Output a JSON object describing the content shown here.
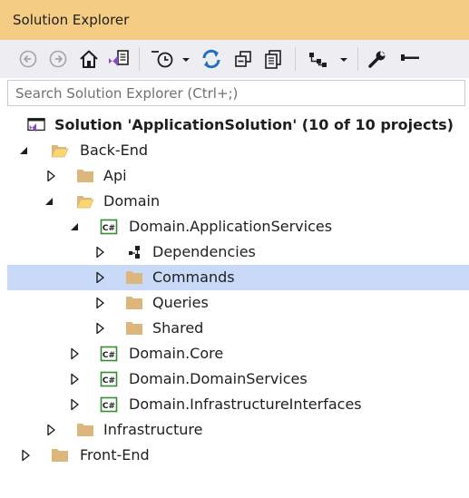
{
  "window": {
    "title": "Solution Explorer"
  },
  "toolbar": {
    "buttons": [
      {
        "name": "back-button",
        "icon": "back-arrow-icon"
      },
      {
        "name": "forward-button",
        "icon": "forward-arrow-icon"
      },
      {
        "name": "home-button",
        "icon": "home-icon"
      },
      {
        "name": "switch-views-button",
        "icon": "switch-views-icon"
      },
      {
        "name": "pending-changes-filter-button",
        "icon": "clock-icon"
      },
      {
        "name": "sync-active-document-button",
        "icon": "sync-icon"
      },
      {
        "name": "collapse-all-button",
        "icon": "collapse-all-icon"
      },
      {
        "name": "show-all-files-button",
        "icon": "show-all-files-icon"
      },
      {
        "name": "view-class-diagram-button",
        "icon": "hierarchy-icon"
      },
      {
        "name": "properties-button",
        "icon": "wrench-icon"
      },
      {
        "name": "preview-selected-items-button",
        "icon": "preview-icon"
      }
    ],
    "colors": {
      "disabled": "#a5a5a5",
      "enabled": "#1e1e1e",
      "accent": "#1f6fc5"
    }
  },
  "search": {
    "placeholder": "Search Solution Explorer (Ctrl+;)",
    "value": ""
  },
  "tree": {
    "solution": {
      "label": "Solution 'ApplicationSolution' (10 of 10 projects)"
    },
    "items": [
      {
        "label": "Back-End",
        "kind": "folder-open",
        "expanded": true,
        "level": 1
      },
      {
        "label": "Api",
        "kind": "folder",
        "expanded": false,
        "level": 2
      },
      {
        "label": "Domain",
        "kind": "folder-open",
        "expanded": true,
        "level": 2
      },
      {
        "label": "Domain.ApplicationServices",
        "kind": "csharp-project",
        "expanded": true,
        "level": 3
      },
      {
        "label": "Dependencies",
        "kind": "dependencies",
        "expanded": false,
        "level": 4
      },
      {
        "label": "Commands",
        "kind": "folder",
        "expanded": false,
        "level": 4,
        "selected": true
      },
      {
        "label": "Queries",
        "kind": "folder",
        "expanded": false,
        "level": 4
      },
      {
        "label": "Shared",
        "kind": "folder",
        "expanded": false,
        "level": 4
      },
      {
        "label": "Domain.Core",
        "kind": "csharp-project",
        "expanded": false,
        "level": 3
      },
      {
        "label": "Domain.DomainServices",
        "kind": "csharp-project",
        "expanded": false,
        "level": 3
      },
      {
        "label": "Domain.InfrastructureInterfaces",
        "kind": "csharp-project",
        "expanded": false,
        "level": 3
      },
      {
        "label": "Infrastructure",
        "kind": "folder",
        "expanded": false,
        "level": 2
      },
      {
        "label": "Front-End",
        "kind": "folder",
        "expanded": false,
        "level": 1
      }
    ],
    "colors": {
      "selected": "#c9daf8",
      "folder": "#dcb67a",
      "csharp": "#388a34"
    }
  }
}
